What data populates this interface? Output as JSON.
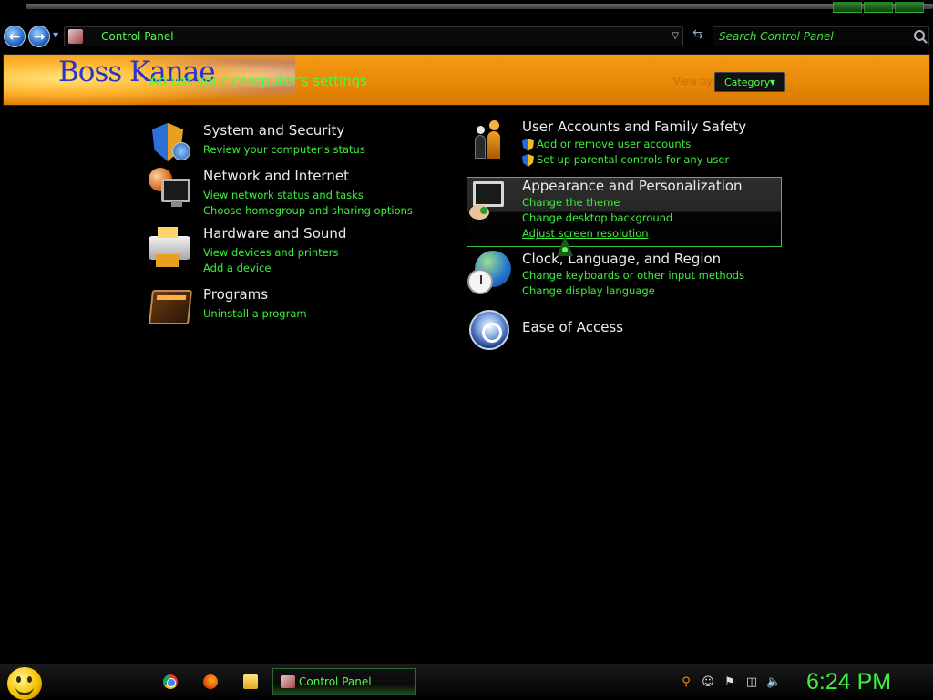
{
  "nav": {
    "address": "Control Panel",
    "search_placeholder": "Search Control Panel"
  },
  "header": {
    "brand": "Boss Kanae",
    "title": "Adjust your computer's settings",
    "view_by_label": "View by:",
    "view_by_value": "Category"
  },
  "categories": [
    {
      "title": "System and Security",
      "links": [
        "Review your computer's status"
      ]
    },
    {
      "title": "Network and Internet",
      "links": [
        "View network status and tasks",
        "Choose homegroup and sharing options"
      ]
    },
    {
      "title": "Hardware and Sound",
      "links": [
        "View devices and printers",
        "Add a device"
      ]
    },
    {
      "title": "Programs",
      "links": [
        "Uninstall a program"
      ]
    },
    {
      "title": "User Accounts and Family Safety",
      "links": [
        "Add or remove user accounts",
        "Set up parental controls for any user"
      ]
    },
    {
      "title": "Appearance and Personalization",
      "links": [
        "Change the theme",
        "Change desktop background",
        "Adjust screen resolution"
      ]
    },
    {
      "title": "Clock, Language, and Region",
      "links": [
        "Change keyboards or other input methods",
        "Change display language"
      ]
    },
    {
      "title": "Ease of Access",
      "links": []
    }
  ],
  "taskbar": {
    "task_label": "Control Panel",
    "clock": "6:24 PM"
  },
  "colors": {
    "accent_green": "#3cf03c",
    "banner_orange": "#e88a08",
    "background": "#000000"
  }
}
